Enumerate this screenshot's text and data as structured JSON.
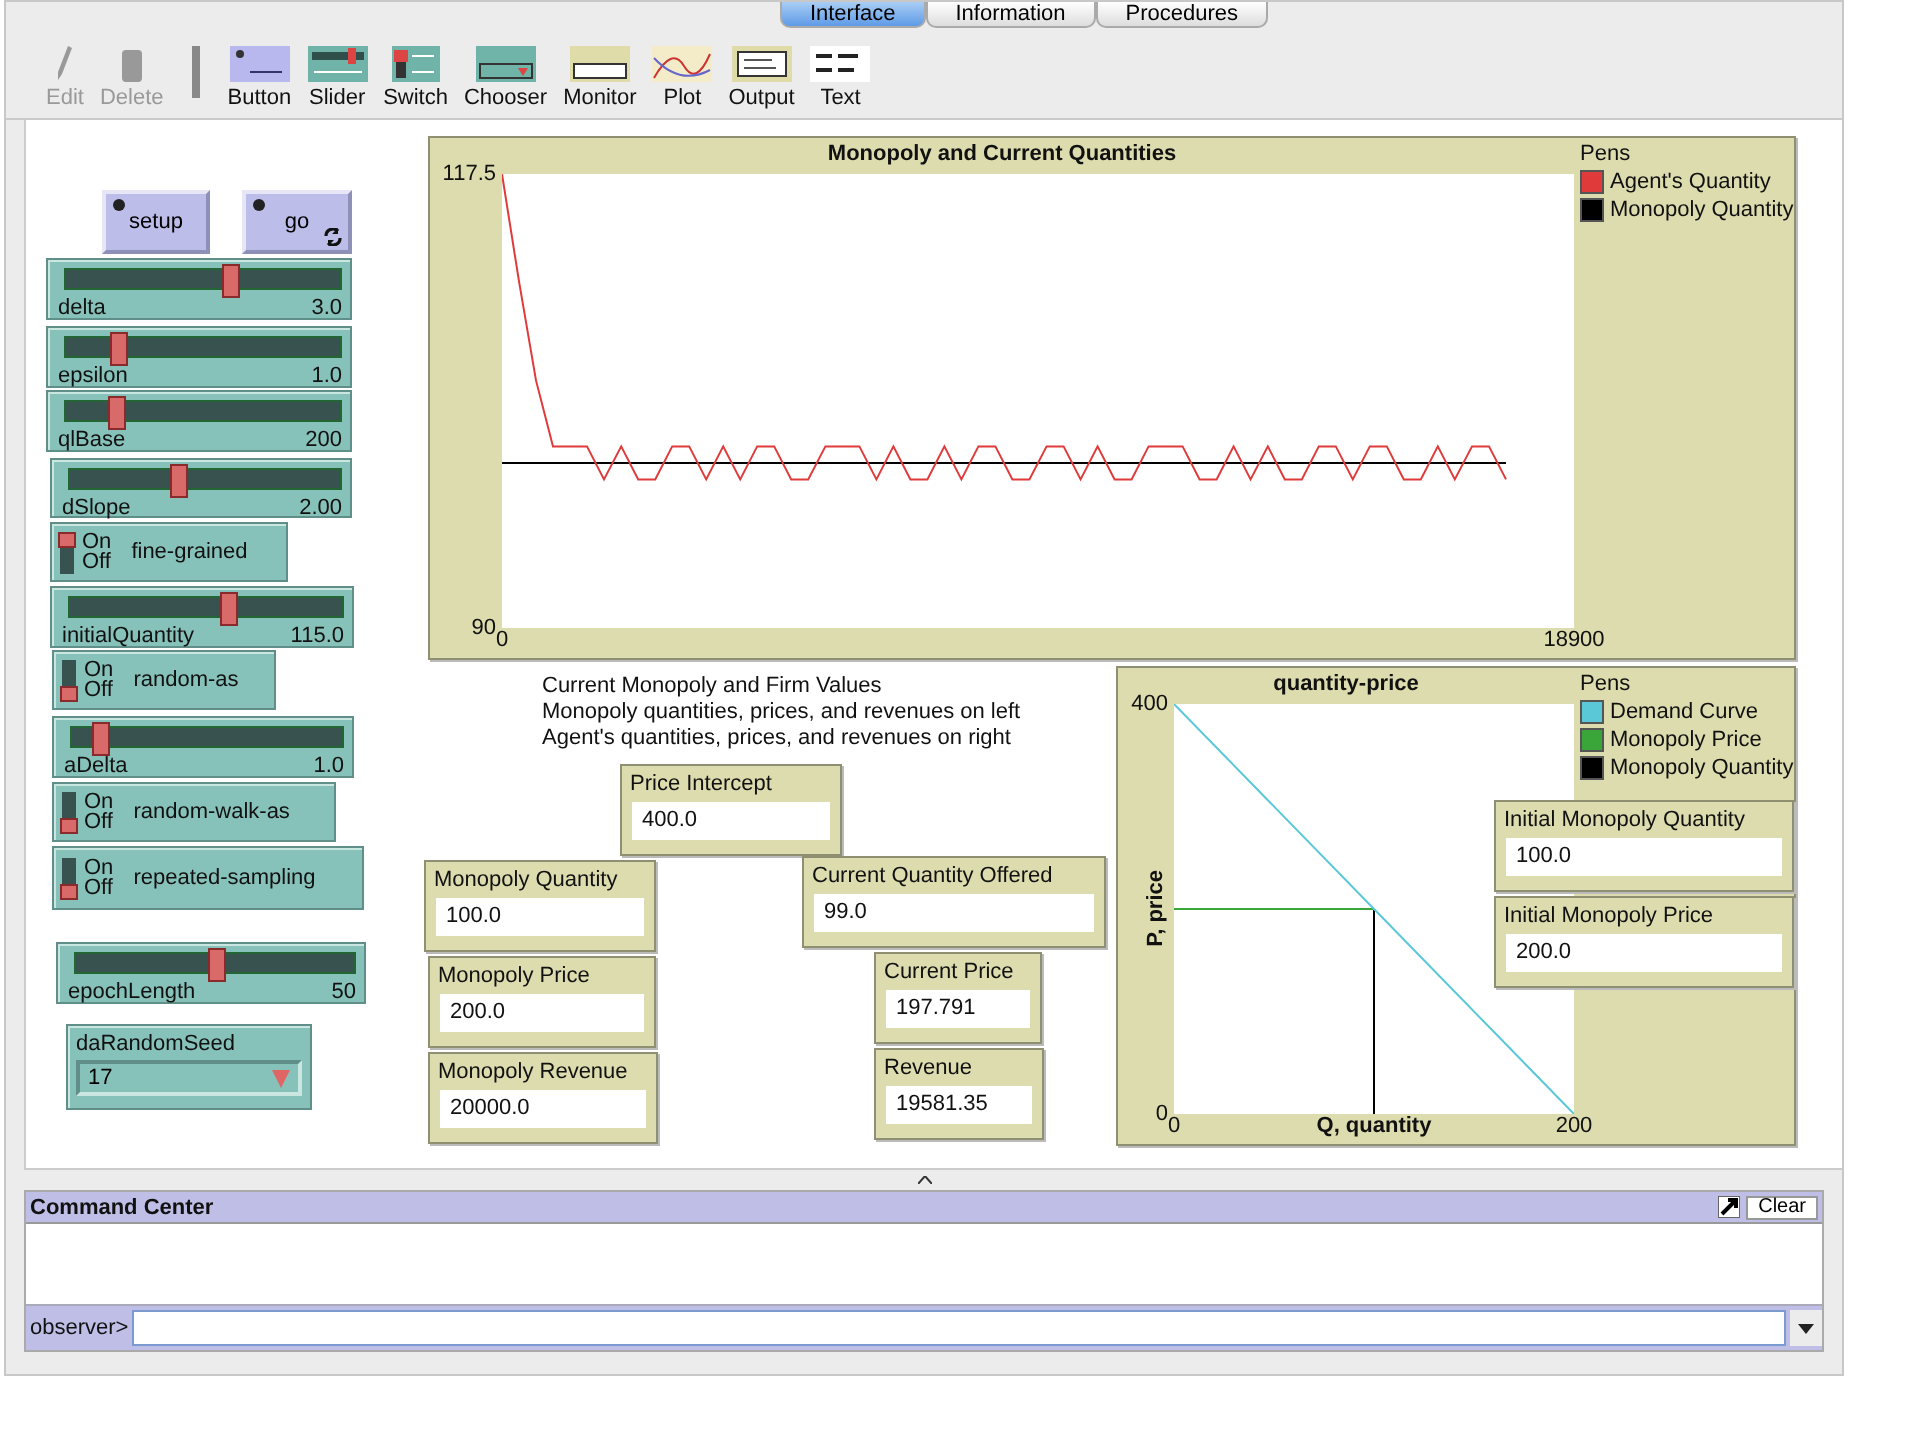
{
  "tabs": [
    {
      "label": "Interface",
      "selected": true
    },
    {
      "label": "Information",
      "selected": false
    },
    {
      "label": "Procedures",
      "selected": false
    }
  ],
  "toolbar": [
    {
      "kind": "edit",
      "label": "Edit",
      "disabled": true
    },
    {
      "kind": "delete",
      "label": "Delete",
      "disabled": true
    },
    {
      "kind": "button",
      "label": "Button",
      "disabled": false
    },
    {
      "kind": "slider",
      "label": "Slider",
      "disabled": false
    },
    {
      "kind": "switch",
      "label": "Switch",
      "disabled": false
    },
    {
      "kind": "chooser",
      "label": "Chooser",
      "disabled": false
    },
    {
      "kind": "monitor",
      "label": "Monitor",
      "disabled": false
    },
    {
      "kind": "plot",
      "label": "Plot",
      "disabled": false
    },
    {
      "kind": "output",
      "label": "Output",
      "disabled": false
    },
    {
      "kind": "text",
      "label": "Text",
      "disabled": false
    }
  ],
  "buttons": [
    {
      "label": "setup",
      "forever": false
    },
    {
      "label": "go",
      "forever": true
    }
  ],
  "widgets": [
    {
      "kind": "slider",
      "name": "delta",
      "value": "3.0",
      "level": 0.6
    },
    {
      "kind": "slider",
      "name": "epsilon",
      "value": "1.0",
      "level": 0.19
    },
    {
      "kind": "slider",
      "name": "qlBase",
      "value": "200",
      "level": 0.18
    },
    {
      "kind": "slider",
      "name": "dSlope",
      "value": "2.00",
      "level": 0.4
    },
    {
      "kind": "switch",
      "name": "fine-grained",
      "on_label": "On",
      "off_label": "Off",
      "on": true
    },
    {
      "kind": "slider",
      "name": "initialQuantity",
      "value": "115.0",
      "level": 0.58
    },
    {
      "kind": "switch",
      "name": "random-as",
      "on_label": "On",
      "off_label": "Off",
      "on": false
    },
    {
      "kind": "slider",
      "name": "aDelta",
      "value": "1.0",
      "level": 0.1
    },
    {
      "kind": "switch",
      "name": "random-walk-as",
      "on_label": "On",
      "off_label": "Off",
      "on": false
    },
    {
      "kind": "switch",
      "name": "repeated-sampling",
      "on_label": "On",
      "off_label": "Off",
      "on": false
    },
    {
      "kind": "slider",
      "name": "epochLength",
      "value": "50",
      "level": 0.5
    },
    {
      "kind": "chooser",
      "name": "daRandomSeed",
      "value": "17"
    }
  ],
  "plots": [
    {
      "pens_label": "Pens",
      "chart_data": {
        "type": "line",
        "legend": "right",
        "title": "Monopoly and Current Quantities",
        "xlim": [
          0,
          18900
        ],
        "ylim": [
          90,
          117.5
        ],
        "xticks": [
          0,
          18900
        ],
        "yticks": [
          90,
          117.5
        ],
        "x": [
          0,
          300,
          600,
          900,
          1200,
          1500,
          1800,
          2100,
          2400,
          2700,
          3000,
          3300,
          3600,
          3900,
          4200,
          4500,
          4800,
          5100,
          5400,
          5700,
          6000,
          6300,
          6600,
          6900,
          7200,
          7500,
          7800,
          8100,
          8400,
          8700,
          9000,
          9300,
          9600,
          9900,
          10200,
          10500,
          10800,
          11100,
          11400,
          11700,
          12000,
          12300,
          12600,
          12900,
          13200,
          13500,
          13800,
          14100,
          14400,
          14700,
          15000,
          15300,
          15600,
          15900,
          16200,
          16500,
          16800,
          17100,
          17400,
          17700
        ],
        "series": [
          {
            "name": "Agent's Quantity",
            "color": "#e03a3a",
            "values": [
              117.5,
              111,
              105,
              101,
              101,
              101,
              99,
              101,
              99,
              99,
              101,
              101,
              99,
              101,
              99,
              101,
              101,
              99,
              99,
              101,
              101,
              101,
              99,
              101,
              99,
              99,
              101,
              99,
              101,
              101,
              99,
              99,
              101,
              101,
              99,
              101,
              99,
              99,
              101,
              101,
              101,
              99,
              99,
              101,
              99,
              101,
              99,
              99,
              101,
              101,
              99,
              101,
              101,
              99,
              99,
              101,
              99,
              101,
              101,
              99
            ]
          },
          {
            "name": "Monopoly Quantity",
            "color": "#000000",
            "values": [
              100,
              100,
              100,
              100,
              100,
              100,
              100,
              100,
              100,
              100,
              100,
              100,
              100,
              100,
              100,
              100,
              100,
              100,
              100,
              100,
              100,
              100,
              100,
              100,
              100,
              100,
              100,
              100,
              100,
              100,
              100,
              100,
              100,
              100,
              100,
              100,
              100,
              100,
              100,
              100,
              100,
              100,
              100,
              100,
              100,
              100,
              100,
              100,
              100,
              100,
              100,
              100,
              100,
              100,
              100,
              100,
              100,
              100,
              100,
              100
            ]
          }
        ]
      }
    },
    {
      "pens_label": "Pens",
      "chart_data": {
        "type": "line",
        "legend": "right",
        "title": "quantity-price",
        "xlabel": "Q, quantity",
        "ylabel": "P, price",
        "xlim": [
          0,
          200
        ],
        "ylim": [
          0,
          400
        ],
        "xticks": [
          0,
          200
        ],
        "yticks": [
          0,
          400
        ],
        "x": [
          0,
          100,
          100,
          200
        ],
        "series": [
          {
            "name": "Demand Curve",
            "color": "#5bc8d8",
            "values": [
              400,
              200,
              200,
              0
            ]
          },
          {
            "name": "Monopoly Price",
            "color": "#3aa63a",
            "values": [
              200,
              200,
              null,
              null
            ]
          },
          {
            "name": "Monopoly Quantity",
            "color": "#000000",
            "values": [
              null,
              0,
              200,
              null
            ]
          }
        ]
      }
    }
  ],
  "note": [
    "Current Monopoly and Firm Values",
    "Monopoly quantities, prices, and revenues on left",
    "Agent's quantities, prices, and revenues on right"
  ],
  "monitors": [
    {
      "label": "Price Intercept",
      "value": "400.0"
    },
    {
      "label": "Monopoly Quantity",
      "value": "100.0"
    },
    {
      "label": "Current Quantity Offered",
      "value": "99.0"
    },
    {
      "label": "Monopoly Price",
      "value": "200.0"
    },
    {
      "label": "Current Price",
      "value": "197.791"
    },
    {
      "label": "Monopoly Revenue",
      "value": "20000.0"
    },
    {
      "label": "Revenue",
      "value": "19581.35"
    },
    {
      "label": "Initial Monopoly Quantity",
      "value": "100.0"
    },
    {
      "label": "Initial Monopoly Price",
      "value": "200.0"
    }
  ],
  "command_center": {
    "title": "Command Center",
    "clear": "Clear",
    "prompt": "observer>"
  }
}
